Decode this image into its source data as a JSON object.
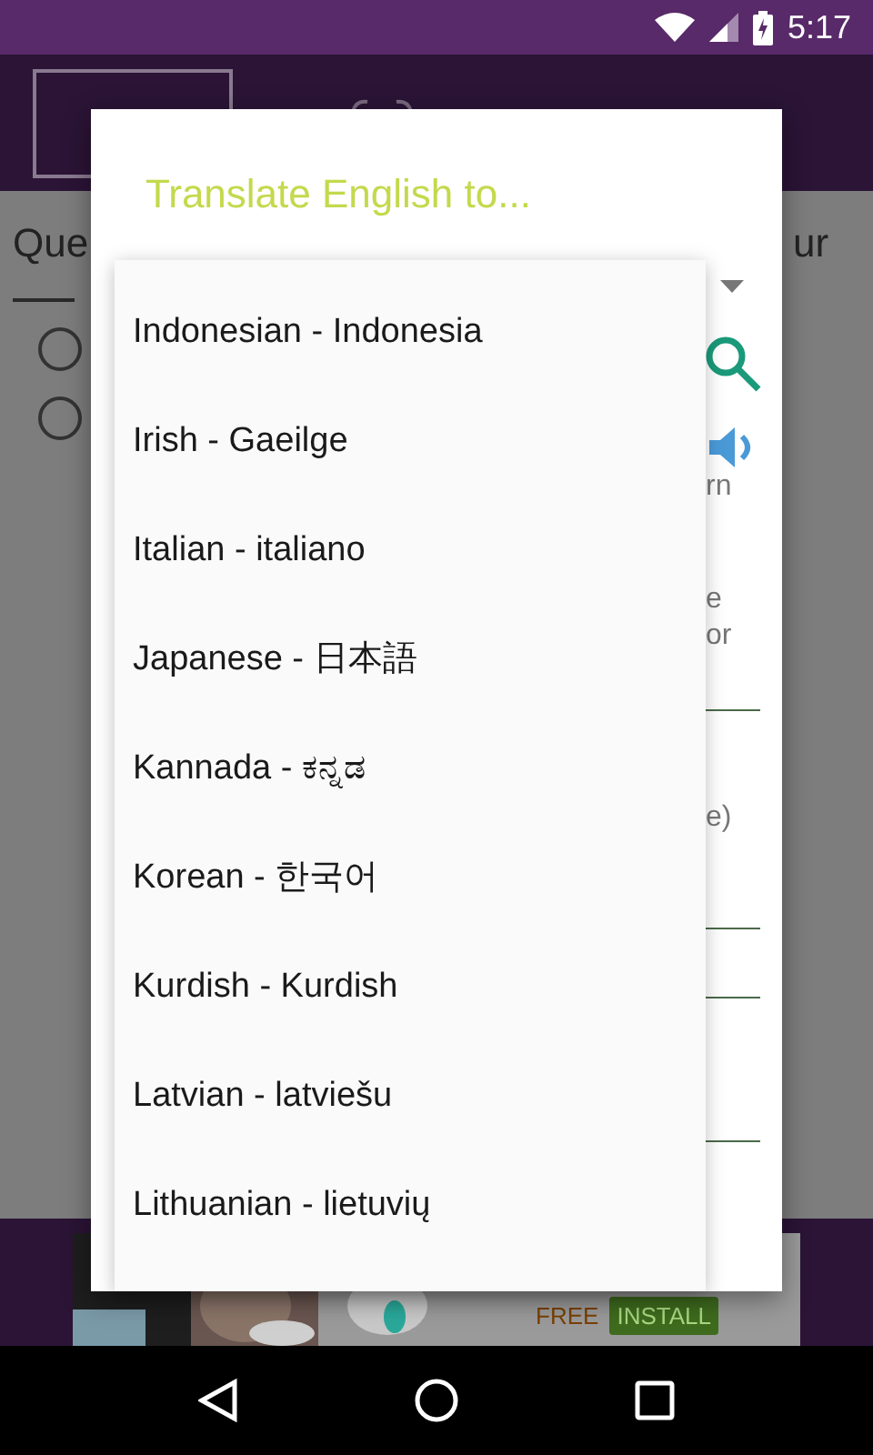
{
  "status_bar": {
    "time": "5:17"
  },
  "background": {
    "heading_left": "Que",
    "heading_right": "ur",
    "radios": [
      {
        "checked": false
      },
      {
        "checked": false
      }
    ]
  },
  "dialog": {
    "title": "Translate English to...",
    "side_texts": [
      {
        "text": "rn",
        "kind": "label"
      },
      {
        "text": "e",
        "kind": "label"
      },
      {
        "text": "or",
        "kind": "label"
      },
      {
        "text": "e)",
        "kind": "label"
      }
    ]
  },
  "dropdown": {
    "items": [
      {
        "label": "Indonesian - Indonesia"
      },
      {
        "label": "Irish - Gaeilge"
      },
      {
        "label": "Italian - italiano"
      },
      {
        "label": "Japanese - 日本語"
      },
      {
        "label": "Kannada - ಕನ್ನಡ"
      },
      {
        "label": "Korean - 한국어"
      },
      {
        "label": "Kurdish - Kurdish"
      },
      {
        "label": "Latvian - latviešu"
      },
      {
        "label": "Lithuanian - lietuvių"
      }
    ]
  },
  "ad": {
    "price": "FREE",
    "action": "INSTALL"
  }
}
